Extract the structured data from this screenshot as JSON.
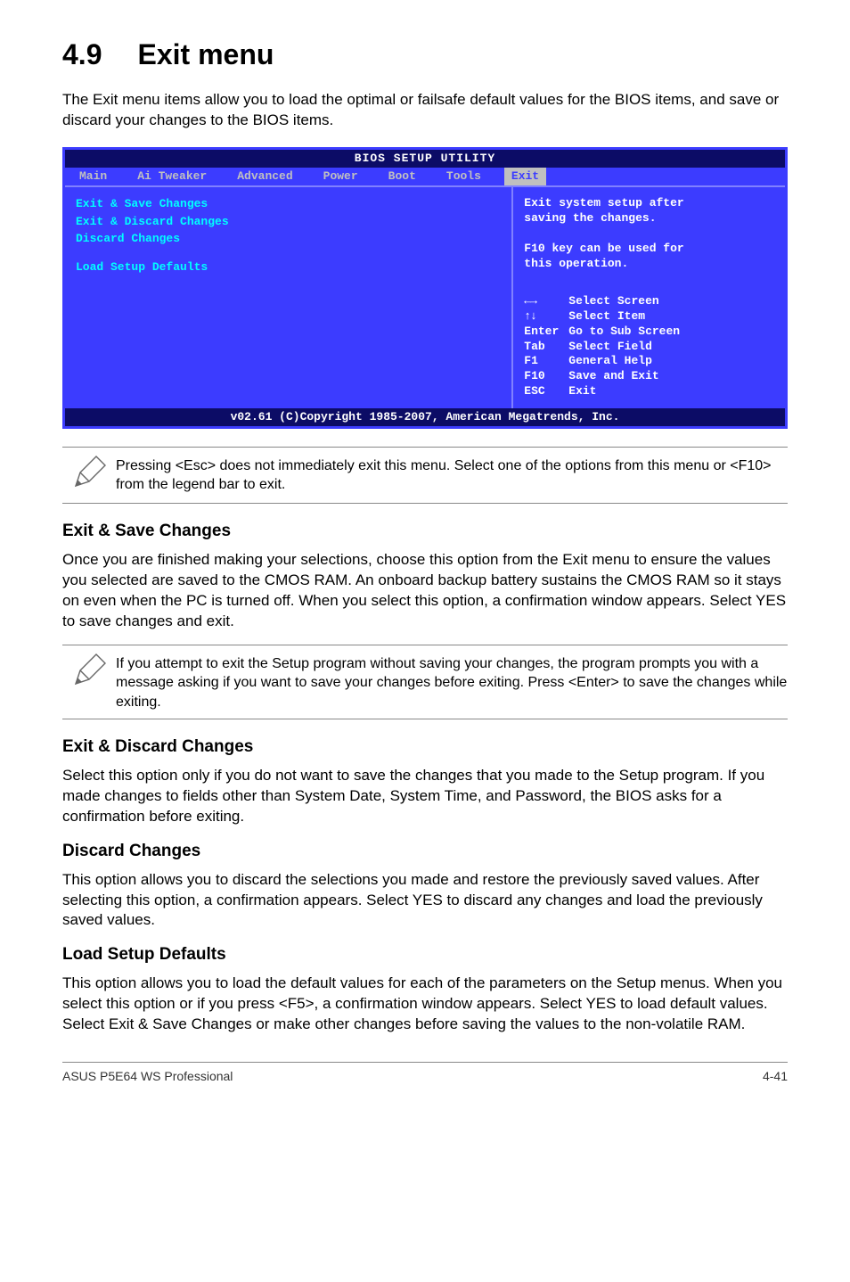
{
  "section": {
    "number": "4.9",
    "title": "Exit menu"
  },
  "intro": "The Exit menu items allow you to load the optimal or failsafe default values for the BIOS items, and save or discard your changes to the BIOS items.",
  "bios": {
    "titlebar": "BIOS SETUP UTILITY",
    "tabs": [
      "Main",
      "Ai Tweaker",
      "Advanced",
      "Power",
      "Boot",
      "Tools",
      "Exit"
    ],
    "active_tab": "Exit",
    "menu_items": [
      "Exit & Save Changes",
      "Exit & Discard Changes",
      "Discard Changes",
      "Load Setup Defaults"
    ],
    "help_top": [
      "Exit system setup after",
      "saving the changes.",
      "",
      "F10 key can be used for",
      "this operation."
    ],
    "help_bottom": [
      {
        "key_glyph": "←→",
        "label": "Select Screen"
      },
      {
        "key_glyph": "↑↓",
        "label": "Select Item"
      },
      {
        "key_glyph": "Enter",
        "label": "Go to Sub Screen"
      },
      {
        "key_glyph": "Tab",
        "label": "Select Field"
      },
      {
        "key_glyph": "F1",
        "label": "General Help"
      },
      {
        "key_glyph": "F10",
        "label": "Save and Exit"
      },
      {
        "key_glyph": "ESC",
        "label": "Exit"
      }
    ],
    "footer": "v02.61 (C)Copyright 1985-2007, American Megatrends, Inc."
  },
  "note1": "Pressing <Esc> does not immediately exit this menu. Select one of the options from this menu or <F10> from the legend bar to exit.",
  "sections": {
    "s1": {
      "title": "Exit & Save Changes",
      "body": "Once you are finished making your selections, choose this option from the Exit menu to ensure the values you selected are saved to the CMOS RAM. An onboard backup battery sustains the CMOS RAM so it stays on even when the PC is turned off. When you select this option, a confirmation window appears. Select YES to save changes and exit."
    },
    "note2": " If you attempt to exit the Setup program without saving your changes, the program prompts you with a message asking if you want to save your changes before exiting. Press <Enter>  to save the  changes while exiting.",
    "s2": {
      "title": "Exit & Discard Changes",
      "body": "Select this option only if you do not want to save the changes that you  made to the Setup program. If you made changes to fields other than System Date, System Time, and Password, the BIOS asks for a confirmation before exiting."
    },
    "s3": {
      "title": "Discard Changes",
      "body": "This option allows you to discard the selections you made and restore the previously saved values. After selecting this option, a confirmation appears. Select YES to discard any changes and load the previously saved values."
    },
    "s4": {
      "title": "Load Setup Defaults",
      "body": "This option allows you to load the default values for each of the parameters on the Setup menus. When you select this option or if you press <F5>, a confirmation window appears. Select YES to load default values. Select Exit & Save Changes or make other changes before saving the values to the non-volatile RAM."
    }
  },
  "footer": {
    "left": "ASUS P5E64 WS Professional",
    "right": "4-41"
  }
}
